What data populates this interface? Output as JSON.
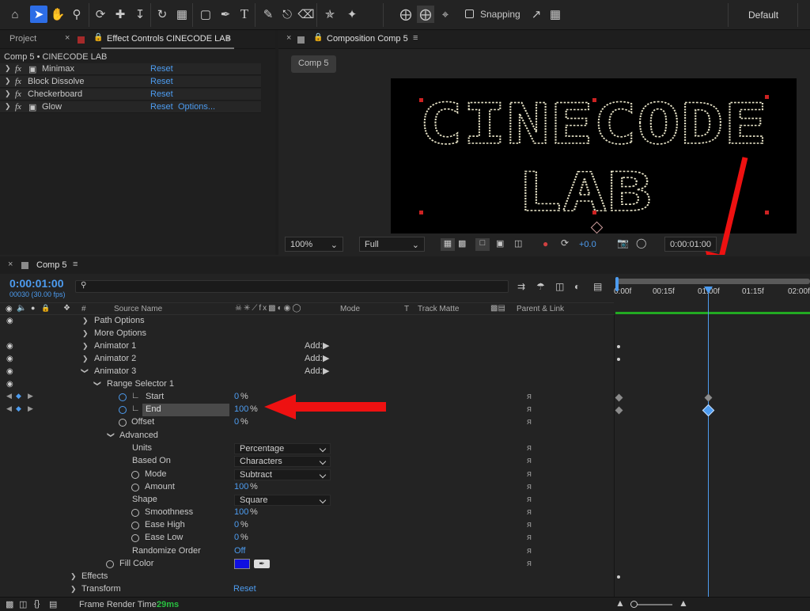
{
  "toolbar": {
    "snapping_label": "Snapping",
    "workspace_label": "Default",
    "tools": [
      "home-icon",
      "selection-tool-icon",
      "hand-tool-icon",
      "zoom-tool-icon",
      "orbit-camera-icon",
      "pan-camera-icon",
      "dolly-camera-icon",
      "rotation-tool-icon",
      "anchor-point-tool-icon",
      "rectangle-tool-icon",
      "pen-tool-icon",
      "type-tool-icon",
      "brush-tool-icon",
      "clone-stamp-tool-icon",
      "eraser-tool-icon",
      "roto-brush-tool-icon",
      "puppet-pin-tool-icon"
    ]
  },
  "left_panel": {
    "tab_project": "Project",
    "tab_effect_controls": "Effect Controls CINECODE LAB",
    "breadcrumb": "Comp 5 • CINECODE LAB",
    "effects": [
      {
        "name": "Minimax",
        "reset": "Reset",
        "extra": ""
      },
      {
        "name": "Block Dissolve",
        "reset": "Reset",
        "extra": ""
      },
      {
        "name": "Checkerboard",
        "reset": "Reset",
        "extra": ""
      },
      {
        "name": "Glow",
        "reset": "Reset",
        "extra": "Options..."
      }
    ]
  },
  "composition": {
    "tab_label": "Composition Comp 5",
    "comp_button": "Comp 5",
    "canvas_text_line1": "CINECODE",
    "canvas_text_line2": "LAB",
    "zoom": "100%",
    "resolution": "Full",
    "exposure": "+0.0",
    "timecode": "0:00:01:00"
  },
  "timeline": {
    "tab_label": "Comp 5",
    "current_time": "0:00:01:00",
    "fps_info": "00030 (30.00 fps)",
    "search_placeholder": "",
    "headers": {
      "num": "#",
      "source_name": "Source Name",
      "mode": "Mode",
      "t": "T",
      "track_matte": "Track Matte",
      "parent_link": "Parent & Link"
    },
    "ruler": [
      "0:00f",
      "00:15f",
      "01:00f",
      "01:15f",
      "02:00f"
    ],
    "rows": {
      "path_options": "Path Options",
      "more_options": "More Options",
      "animator1": "Animator 1",
      "animator2": "Animator 2",
      "animator3": "Animator 3",
      "add_label": "Add:",
      "range_selector": "Range Selector 1",
      "start": "Start",
      "start_val": "0",
      "end": "End",
      "end_val": "100",
      "offset": "Offset",
      "offset_val": "0",
      "advanced": "Advanced",
      "units": "Units",
      "units_val": "Percentage",
      "based_on": "Based On",
      "based_on_val": "Characters",
      "mode": "Mode",
      "mode_val": "Subtract",
      "amount": "Amount",
      "amount_val": "100",
      "shape": "Shape",
      "shape_val": "Square",
      "smoothness": "Smoothness",
      "smoothness_val": "100",
      "ease_high": "Ease High",
      "ease_high_val": "0",
      "ease_low": "Ease Low",
      "ease_low_val": "0",
      "randomize": "Randomize Order",
      "randomize_val": "Off",
      "fill_color": "Fill Color",
      "effects": "Effects",
      "transform": "Transform",
      "transform_reset": "Reset",
      "percent": "%"
    },
    "footer_label": "Frame Render Time:",
    "footer_value": "29ms"
  },
  "colors": {
    "accent": "#2d6de6",
    "link_blue": "#4d9cf0",
    "fill_color": "#1010e0",
    "arrow_red": "#ee1111",
    "work_area_green": "#22aa22"
  }
}
